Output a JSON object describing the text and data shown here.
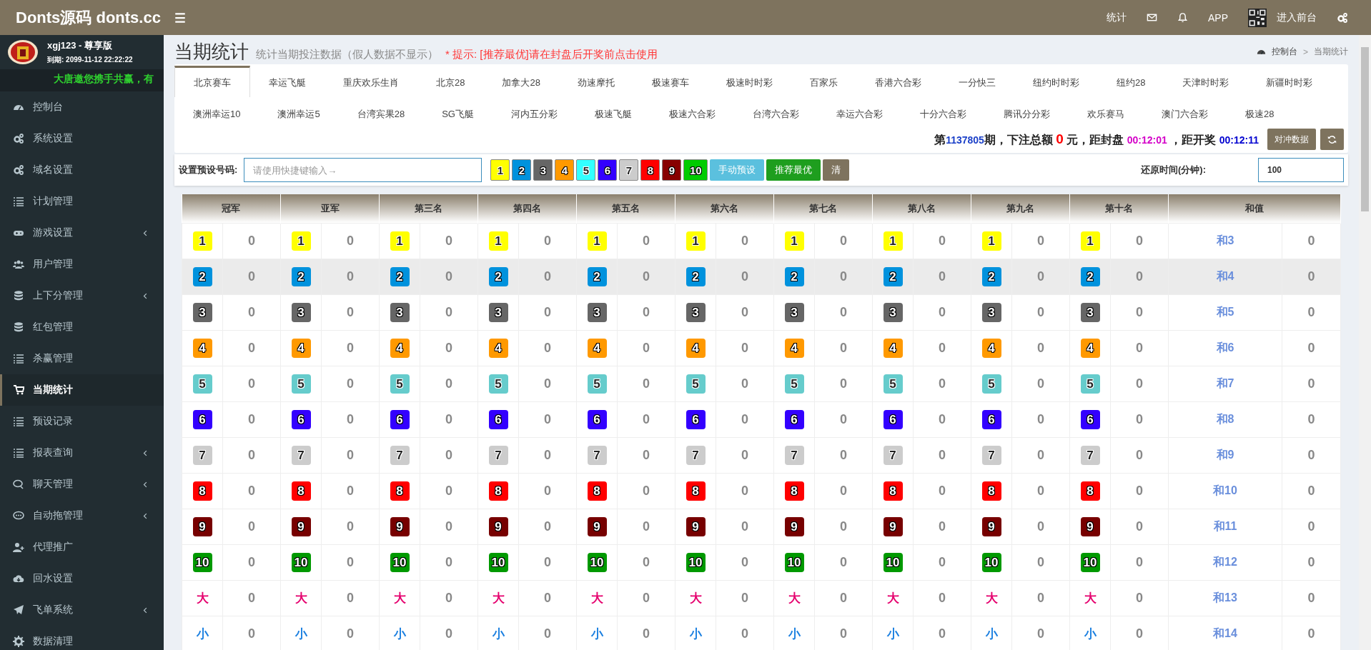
{
  "header": {
    "brand": "Donts源码 donts.cc",
    "stats_link": "统计",
    "app_link": "APP",
    "frontend_link": "进入前台"
  },
  "sidebar": {
    "user": "xgj123 - 尊享版",
    "expiry": "到期: 2099-11-12 22:22:22",
    "marquee": "大唐邀您携手共赢，有",
    "items": [
      {
        "label": "控制台",
        "has_submenu": false,
        "selected": false
      },
      {
        "label": "系统设置",
        "has_submenu": false,
        "selected": false
      },
      {
        "label": "域名设置",
        "has_submenu": false,
        "selected": false
      },
      {
        "label": "计划管理",
        "has_submenu": false,
        "selected": false
      },
      {
        "label": "游戏设置",
        "has_submenu": true,
        "selected": false
      },
      {
        "label": "用户管理",
        "has_submenu": false,
        "selected": false
      },
      {
        "label": "上下分管理",
        "has_submenu": true,
        "selected": false
      },
      {
        "label": "红包管理",
        "has_submenu": false,
        "selected": false
      },
      {
        "label": "杀赢管理",
        "has_submenu": false,
        "selected": false
      },
      {
        "label": "当期统计",
        "has_submenu": false,
        "selected": true
      },
      {
        "label": "预设记录",
        "has_submenu": false,
        "selected": false
      },
      {
        "label": "报表查询",
        "has_submenu": true,
        "selected": false
      },
      {
        "label": "聊天管理",
        "has_submenu": true,
        "selected": false
      },
      {
        "label": "自动拖管理",
        "has_submenu": true,
        "selected": false
      },
      {
        "label": "代理推广",
        "has_submenu": false,
        "selected": false
      },
      {
        "label": "回水设置",
        "has_submenu": false,
        "selected": false
      },
      {
        "label": "飞单系统",
        "has_submenu": true,
        "selected": false
      },
      {
        "label": "数据清理",
        "has_submenu": false,
        "selected": false
      }
    ]
  },
  "page": {
    "title": "当期统计",
    "subtitle": "统计当期投注数据（假人数据不显示）",
    "hint": "* 提示: [推荐最优]请在封盘后开奖前点击使用",
    "breadcrumb": [
      "控制台",
      "当期统计"
    ],
    "breadcrumb_separator": ">"
  },
  "tabs": [
    {
      "label": "北京赛车",
      "selected": true
    },
    {
      "label": "幸运飞艇",
      "selected": false
    },
    {
      "label": "重庆欢乐生肖",
      "selected": false
    },
    {
      "label": "北京28",
      "selected": false
    },
    {
      "label": "加拿大28",
      "selected": false
    },
    {
      "label": "劲速摩托",
      "selected": false
    },
    {
      "label": "极速赛车",
      "selected": false
    },
    {
      "label": "极速时时彩",
      "selected": false
    },
    {
      "label": "百家乐",
      "selected": false
    },
    {
      "label": "香港六合彩",
      "selected": false
    },
    {
      "label": "一分快三",
      "selected": false
    },
    {
      "label": "纽约时时彩",
      "selected": false
    },
    {
      "label": "纽约28",
      "selected": false
    },
    {
      "label": "天津时时彩",
      "selected": false
    },
    {
      "label": "新疆时时彩",
      "selected": false
    },
    {
      "label": "澳洲幸运10",
      "selected": false
    },
    {
      "label": "澳洲幸运5",
      "selected": false
    },
    {
      "label": "台湾宾果28",
      "selected": false
    },
    {
      "label": "SG飞艇",
      "selected": false
    },
    {
      "label": "河内五分彩",
      "selected": false
    },
    {
      "label": "极速飞艇",
      "selected": false
    },
    {
      "label": "极速六合彩",
      "selected": false
    },
    {
      "label": "台湾六合彩",
      "selected": false
    },
    {
      "label": "幸运六合彩",
      "selected": false
    },
    {
      "label": "十分六合彩",
      "selected": false
    },
    {
      "label": "腾讯分分彩",
      "selected": false
    },
    {
      "label": "欢乐赛马",
      "selected": false
    },
    {
      "label": "澳门六合彩",
      "selected": false
    },
    {
      "label": "极速28",
      "selected": false
    }
  ],
  "status": {
    "segments": [
      {
        "kind": "label",
        "text": "第"
      },
      {
        "kind": "period",
        "text": "1137805"
      },
      {
        "kind": "label",
        "text": "期，下注总额 "
      },
      {
        "kind": "amount",
        "text": "0"
      },
      {
        "kind": "label",
        "text": " 元，距封盘 "
      },
      {
        "kind": "close",
        "text": "00:12:01"
      },
      {
        "kind": "label",
        "text": " ，距开奖 "
      },
      {
        "kind": "draw",
        "text": "00:12:11"
      }
    ],
    "hedge_button": "对冲数据"
  },
  "preset": {
    "label": "设置预设号码:",
    "placeholder": "请使用快捷键输入→",
    "numbers": [
      {
        "label": "1",
        "color": "#ffff00"
      },
      {
        "label": "2",
        "color": "#0092dd"
      },
      {
        "label": "3",
        "color": "#666666"
      },
      {
        "label": "4",
        "color": "#ff9900"
      },
      {
        "label": "5",
        "color": "#33ffff"
      },
      {
        "label": "6",
        "color": "#3300ff"
      },
      {
        "label": "7",
        "color": "#cccccc"
      },
      {
        "label": "8",
        "color": "#ff0000"
      },
      {
        "label": "9",
        "color": "#880000"
      },
      {
        "label": "10",
        "color": "#00cc00"
      }
    ],
    "manual_button": "手动预设",
    "recommend_button": "推荐最优",
    "clear_button": "清",
    "restore_label": "还原时间(分钟):",
    "restore_value": "100"
  },
  "table": {
    "columns": [
      "冠军",
      "亚军",
      "第三名",
      "第四名",
      "第五名",
      "第六名",
      "第七名",
      "第八名",
      "第九名",
      "第十名",
      "和值"
    ],
    "rows": [
      {
        "kind": "ball",
        "color": "#ffff00",
        "highlighted": false,
        "cells": [
          {
            "ball": "1",
            "count": "0"
          },
          {
            "ball": "1",
            "count": "0"
          },
          {
            "ball": "1",
            "count": "0"
          },
          {
            "ball": "1",
            "count": "0"
          },
          {
            "ball": "1",
            "count": "0"
          },
          {
            "ball": "1",
            "count": "0"
          },
          {
            "ball": "1",
            "count": "0"
          },
          {
            "ball": "1",
            "count": "0"
          },
          {
            "ball": "1",
            "count": "0"
          },
          {
            "ball": "1",
            "count": "0"
          }
        ],
        "sum_label": "和3",
        "sum_count": "0"
      },
      {
        "kind": "ball",
        "color": "#0092dd",
        "highlighted": true,
        "cells": [
          {
            "ball": "2",
            "count": "0"
          },
          {
            "ball": "2",
            "count": "0"
          },
          {
            "ball": "2",
            "count": "0"
          },
          {
            "ball": "2",
            "count": "0"
          },
          {
            "ball": "2",
            "count": "0"
          },
          {
            "ball": "2",
            "count": "0"
          },
          {
            "ball": "2",
            "count": "0"
          },
          {
            "ball": "2",
            "count": "0"
          },
          {
            "ball": "2",
            "count": "0"
          },
          {
            "ball": "2",
            "count": "0"
          }
        ],
        "sum_label": "和4",
        "sum_count": "0"
      },
      {
        "kind": "ball",
        "color": "#666666",
        "highlighted": false,
        "cells": [
          {
            "ball": "3",
            "count": "0"
          },
          {
            "ball": "3",
            "count": "0"
          },
          {
            "ball": "3",
            "count": "0"
          },
          {
            "ball": "3",
            "count": "0"
          },
          {
            "ball": "3",
            "count": "0"
          },
          {
            "ball": "3",
            "count": "0"
          },
          {
            "ball": "3",
            "count": "0"
          },
          {
            "ball": "3",
            "count": "0"
          },
          {
            "ball": "3",
            "count": "0"
          },
          {
            "ball": "3",
            "count": "0"
          }
        ],
        "sum_label": "和5",
        "sum_count": "0"
      },
      {
        "kind": "ball",
        "color": "#ff9900",
        "highlighted": false,
        "cells": [
          {
            "ball": "4",
            "count": "0"
          },
          {
            "ball": "4",
            "count": "0"
          },
          {
            "ball": "4",
            "count": "0"
          },
          {
            "ball": "4",
            "count": "0"
          },
          {
            "ball": "4",
            "count": "0"
          },
          {
            "ball": "4",
            "count": "0"
          },
          {
            "ball": "4",
            "count": "0"
          },
          {
            "ball": "4",
            "count": "0"
          },
          {
            "ball": "4",
            "count": "0"
          },
          {
            "ball": "4",
            "count": "0"
          }
        ],
        "sum_label": "和6",
        "sum_count": "0"
      },
      {
        "kind": "ball",
        "color": "#66cccc",
        "highlighted": false,
        "cells": [
          {
            "ball": "5",
            "count": "0"
          },
          {
            "ball": "5",
            "count": "0"
          },
          {
            "ball": "5",
            "count": "0"
          },
          {
            "ball": "5",
            "count": "0"
          },
          {
            "ball": "5",
            "count": "0"
          },
          {
            "ball": "5",
            "count": "0"
          },
          {
            "ball": "5",
            "count": "0"
          },
          {
            "ball": "5",
            "count": "0"
          },
          {
            "ball": "5",
            "count": "0"
          },
          {
            "ball": "5",
            "count": "0"
          }
        ],
        "sum_label": "和7",
        "sum_count": "0"
      },
      {
        "kind": "ball",
        "color": "#3300ff",
        "highlighted": false,
        "cells": [
          {
            "ball": "6",
            "count": "0"
          },
          {
            "ball": "6",
            "count": "0"
          },
          {
            "ball": "6",
            "count": "0"
          },
          {
            "ball": "6",
            "count": "0"
          },
          {
            "ball": "6",
            "count": "0"
          },
          {
            "ball": "6",
            "count": "0"
          },
          {
            "ball": "6",
            "count": "0"
          },
          {
            "ball": "6",
            "count": "0"
          },
          {
            "ball": "6",
            "count": "0"
          },
          {
            "ball": "6",
            "count": "0"
          }
        ],
        "sum_label": "和8",
        "sum_count": "0"
      },
      {
        "kind": "ball",
        "color": "#cccccc",
        "highlighted": false,
        "cells": [
          {
            "ball": "7",
            "count": "0"
          },
          {
            "ball": "7",
            "count": "0"
          },
          {
            "ball": "7",
            "count": "0"
          },
          {
            "ball": "7",
            "count": "0"
          },
          {
            "ball": "7",
            "count": "0"
          },
          {
            "ball": "7",
            "count": "0"
          },
          {
            "ball": "7",
            "count": "0"
          },
          {
            "ball": "7",
            "count": "0"
          },
          {
            "ball": "7",
            "count": "0"
          },
          {
            "ball": "7",
            "count": "0"
          }
        ],
        "sum_label": "和9",
        "sum_count": "0"
      },
      {
        "kind": "ball",
        "color": "#ff0000",
        "highlighted": false,
        "cells": [
          {
            "ball": "8",
            "count": "0"
          },
          {
            "ball": "8",
            "count": "0"
          },
          {
            "ball": "8",
            "count": "0"
          },
          {
            "ball": "8",
            "count": "0"
          },
          {
            "ball": "8",
            "count": "0"
          },
          {
            "ball": "8",
            "count": "0"
          },
          {
            "ball": "8",
            "count": "0"
          },
          {
            "ball": "8",
            "count": "0"
          },
          {
            "ball": "8",
            "count": "0"
          },
          {
            "ball": "8",
            "count": "0"
          }
        ],
        "sum_label": "和10",
        "sum_count": "0"
      },
      {
        "kind": "ball",
        "color": "#770000",
        "highlighted": false,
        "cells": [
          {
            "ball": "9",
            "count": "0"
          },
          {
            "ball": "9",
            "count": "0"
          },
          {
            "ball": "9",
            "count": "0"
          },
          {
            "ball": "9",
            "count": "0"
          },
          {
            "ball": "9",
            "count": "0"
          },
          {
            "ball": "9",
            "count": "0"
          },
          {
            "ball": "9",
            "count": "0"
          },
          {
            "ball": "9",
            "count": "0"
          },
          {
            "ball": "9",
            "count": "0"
          },
          {
            "ball": "9",
            "count": "0"
          }
        ],
        "sum_label": "和11",
        "sum_count": "0"
      },
      {
        "kind": "ball",
        "color": "#009900",
        "highlighted": false,
        "cells": [
          {
            "ball": "10",
            "count": "0"
          },
          {
            "ball": "10",
            "count": "0"
          },
          {
            "ball": "10",
            "count": "0"
          },
          {
            "ball": "10",
            "count": "0"
          },
          {
            "ball": "10",
            "count": "0"
          },
          {
            "ball": "10",
            "count": "0"
          },
          {
            "ball": "10",
            "count": "0"
          },
          {
            "ball": "10",
            "count": "0"
          },
          {
            "ball": "10",
            "count": "0"
          },
          {
            "ball": "10",
            "count": "0"
          }
        ],
        "sum_label": "和12",
        "sum_count": "0"
      },
      {
        "kind": "word",
        "color": "#e5006e",
        "highlighted": false,
        "cells": [
          {
            "ball": "大",
            "count": "0"
          },
          {
            "ball": "大",
            "count": "0"
          },
          {
            "ball": "大",
            "count": "0"
          },
          {
            "ball": "大",
            "count": "0"
          },
          {
            "ball": "大",
            "count": "0"
          },
          {
            "ball": "大",
            "count": "0"
          },
          {
            "ball": "大",
            "count": "0"
          },
          {
            "ball": "大",
            "count": "0"
          },
          {
            "ball": "大",
            "count": "0"
          },
          {
            "ball": "大",
            "count": "0"
          }
        ],
        "sum_label": "和13",
        "sum_count": "0"
      },
      {
        "kind": "word",
        "color": "#1a7fe0",
        "highlighted": false,
        "cells": [
          {
            "ball": "小",
            "count": "0"
          },
          {
            "ball": "小",
            "count": "0"
          },
          {
            "ball": "小",
            "count": "0"
          },
          {
            "ball": "小",
            "count": "0"
          },
          {
            "ball": "小",
            "count": "0"
          },
          {
            "ball": "小",
            "count": "0"
          },
          {
            "ball": "小",
            "count": "0"
          },
          {
            "ball": "小",
            "count": "0"
          },
          {
            "ball": "小",
            "count": "0"
          },
          {
            "ball": "小",
            "count": "0"
          }
        ],
        "sum_label": "和14",
        "sum_count": "0"
      }
    ]
  }
}
